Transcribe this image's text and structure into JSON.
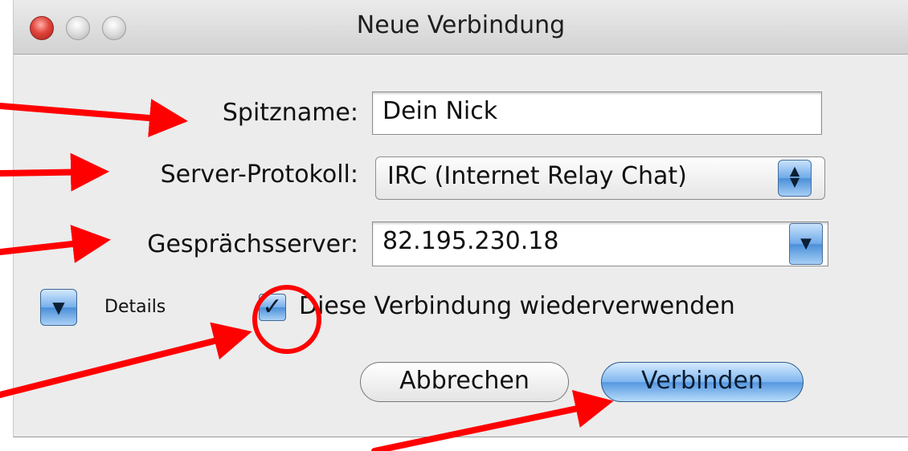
{
  "window": {
    "title": "Neue Verbindung",
    "traffic_lights": [
      "close-light",
      "minimize-light",
      "zoom-light"
    ]
  },
  "form": {
    "nickname_label": "Spitzname:",
    "nickname_value": "Dein Nick",
    "protocol_label": "Server-Protokoll:",
    "protocol_value": "IRC (Internet Relay Chat)",
    "server_label": "Gesprächsserver:",
    "server_value": "82.195.230.18"
  },
  "details": {
    "label": "Details",
    "icon": "disclosure-triangle-icon"
  },
  "reuse": {
    "label": "Diese Verbindung wiederverwenden",
    "checked": true
  },
  "buttons": {
    "cancel_label": "Abbrechen",
    "connect_label": "Verbinden"
  },
  "annotation": {
    "color": "#ff0000",
    "arrow_count": 5,
    "circle_around": "reuse-checkbox"
  },
  "colors": {
    "aqua_blue": "#5597e0",
    "window_bg": "#ececec"
  }
}
